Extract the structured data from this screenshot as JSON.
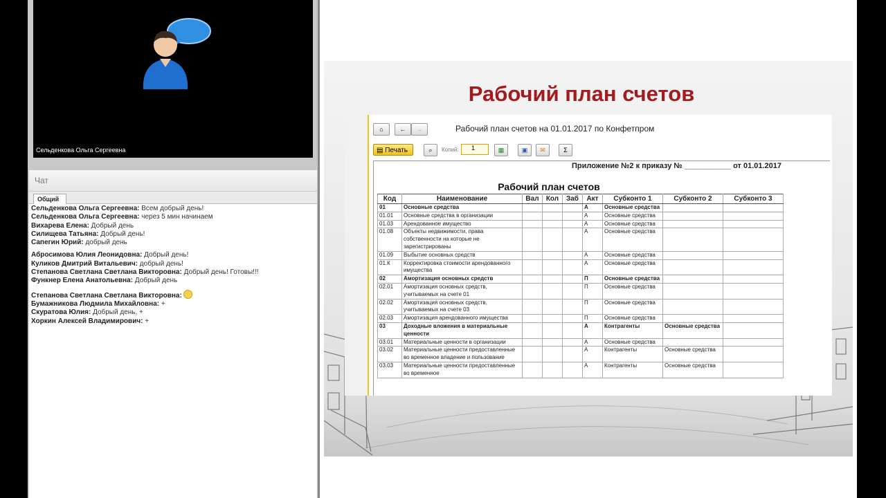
{
  "video": {
    "participant_name": "Сельденкова Ольга Сергеевна"
  },
  "chat": {
    "title": "Чат",
    "tab": "Общий",
    "messages": [
      {
        "author": "Сельденкова Ольга Сергеевна:",
        "text": " Всем добрый день!"
      },
      {
        "author": "Сельденкова Ольга Сергеевна:",
        "text": " через 5 мин начинаем"
      },
      {
        "author": "Вихарева Елена:",
        "text": " Добрый день"
      },
      {
        "author": "Силищева Татьяна:",
        "text": " Добрый день!"
      },
      {
        "author": "Сапегин Юрий:",
        "text": " добрый день"
      },
      {
        "author": "Абросимова Юлия Леонидовна:",
        "text": " Добрый день!"
      },
      {
        "author": "Куликов Дмитрий Витальевич:",
        "text": " добрый день!"
      },
      {
        "author": "Степанова Светлана  Светлана Викторовна:",
        "text": " Добрый день! Готовы!!!"
      },
      {
        "author": "Функнер Елена Анатольевна:",
        "text": " Добрый день"
      },
      {
        "author": "Степанова Светлана  Светлана Викторовна:",
        "text": ""
      },
      {
        "author": "Бумажникова Людмила Михайловна:",
        "text": " +"
      },
      {
        "author": "Скуратова Юлия:",
        "text": " Добрый день, +"
      },
      {
        "author": "Хоркин Алексей Владимирович:",
        "text": " +"
      }
    ]
  },
  "slide": {
    "title": "Рабочий план счетов",
    "doc": {
      "heading": "Рабочий план счетов на 01.01.2017 по Конфетпром",
      "print_label": "Печать",
      "copies_label": "Копий:",
      "copies_value": "1",
      "sum_symbol": "Σ",
      "appendix": "Приложение №2 к приказу № ___________ от 01.01.2017",
      "table_title": "Рабочий план счетов",
      "columns": [
        "Код",
        "Наименование",
        "Вал",
        "Кол",
        "Заб",
        "Акт",
        "Субконто 1",
        "Субконто 2",
        "Субконто 3"
      ],
      "rows": [
        {
          "code": "01",
          "name": "Основные средства",
          "val": "",
          "kol": "",
          "zab": "",
          "akt": "А",
          "s1": "Основные средства",
          "s2": "",
          "s3": "",
          "bold": true
        },
        {
          "code": "01.01",
          "name": "Основные средства в организации",
          "val": "",
          "kol": "",
          "zab": "",
          "akt": "А",
          "s1": "Основные средства",
          "s2": "",
          "s3": "",
          "bold": false
        },
        {
          "code": "01.03",
          "name": "Арендованное имущество",
          "val": "",
          "kol": "",
          "zab": "",
          "akt": "А",
          "s1": "Основные средства",
          "s2": "",
          "s3": "",
          "bold": false
        },
        {
          "code": "01.08",
          "name": "Объекты недвижимости, права собственности на которые не зарегистрированы",
          "val": "",
          "kol": "",
          "zab": "",
          "akt": "А",
          "s1": "Основные средства",
          "s2": "",
          "s3": "",
          "bold": false
        },
        {
          "code": "01.09",
          "name": "Выбытие основных средств",
          "val": "",
          "kol": "",
          "zab": "",
          "akt": "А",
          "s1": "Основные средства",
          "s2": "",
          "s3": "",
          "bold": false
        },
        {
          "code": "01.К",
          "name": "Корректировка стоимости арендованного имущества",
          "val": "",
          "kol": "",
          "zab": "",
          "akt": "А",
          "s1": "Основные средства",
          "s2": "",
          "s3": "",
          "bold": false
        },
        {
          "code": "02",
          "name": "Амортизация основных средств",
          "val": "",
          "kol": "",
          "zab": "",
          "akt": "П",
          "s1": "Основные средства",
          "s2": "",
          "s3": "",
          "bold": true
        },
        {
          "code": "02.01",
          "name": "Амортизация основных средств, учитываемых на счете 01",
          "val": "",
          "kol": "",
          "zab": "",
          "akt": "П",
          "s1": "Основные средства",
          "s2": "",
          "s3": "",
          "bold": false
        },
        {
          "code": "02.02",
          "name": "Амортизация основных средств, учитываемых на счете 03",
          "val": "",
          "kol": "",
          "zab": "",
          "akt": "П",
          "s1": "Основные средства",
          "s2": "",
          "s3": "",
          "bold": false
        },
        {
          "code": "02.03",
          "name": "Амортизация арендованного имущества",
          "val": "",
          "kol": "",
          "zab": "",
          "akt": "П",
          "s1": "Основные средства",
          "s2": "",
          "s3": "",
          "bold": false
        },
        {
          "code": "03",
          "name": "Доходные вложения в материальные ценности",
          "val": "",
          "kol": "",
          "zab": "",
          "akt": "А",
          "s1": "Контрагенты",
          "s2": "Основные средства",
          "s3": "",
          "bold": true
        },
        {
          "code": "03.01",
          "name": "Материальные ценности в организации",
          "val": "",
          "kol": "",
          "zab": "",
          "akt": "А",
          "s1": "Основные средства",
          "s2": "",
          "s3": "",
          "bold": false
        },
        {
          "code": "03.02",
          "name": "Материальные ценности предоставленные во временное владение и пользование",
          "val": "",
          "kol": "",
          "zab": "",
          "akt": "А",
          "s1": "Контрагенты",
          "s2": "Основные средства",
          "s3": "",
          "bold": false
        },
        {
          "code": "03.03",
          "name": "Материальные ценности предоставленные во временное",
          "val": "",
          "kol": "",
          "zab": "",
          "akt": "А",
          "s1": "Контрагенты",
          "s2": "Основные средства",
          "s3": "",
          "bold": false
        }
      ]
    }
  }
}
